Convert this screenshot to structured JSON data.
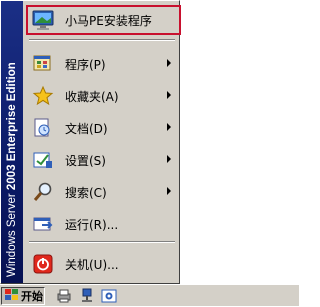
{
  "banner": {
    "word1": "Windows",
    "word2": "Server",
    "word3": "2003",
    "word4": "Enterprise Edition"
  },
  "menu": {
    "items": [
      {
        "label": "小马PE安装程序",
        "icon": "installer-icon",
        "submenu": false,
        "highlighted": true
      },
      {
        "label": "程序(P)",
        "icon": "programs-icon",
        "submenu": true
      },
      {
        "label": "收藏夹(A)",
        "icon": "favorites-star-icon",
        "submenu": true
      },
      {
        "label": "文档(D)",
        "icon": "documents-icon",
        "submenu": true
      },
      {
        "label": "设置(S)",
        "icon": "settings-icon",
        "submenu": true
      },
      {
        "label": "搜索(C)",
        "icon": "search-icon",
        "submenu": true
      },
      {
        "label": "运行(R)...",
        "icon": "run-icon",
        "submenu": false
      },
      {
        "label": "关机(U)...",
        "icon": "shutdown-icon",
        "submenu": false
      }
    ]
  },
  "taskbar": {
    "start_label": "开始",
    "quick_launch": [
      "printer-icon",
      "network-icon",
      "settings-icon"
    ]
  },
  "colors": {
    "highlight_border": "#c8102e",
    "banner": "#0b1a66",
    "shutdown": "#e0281c"
  }
}
